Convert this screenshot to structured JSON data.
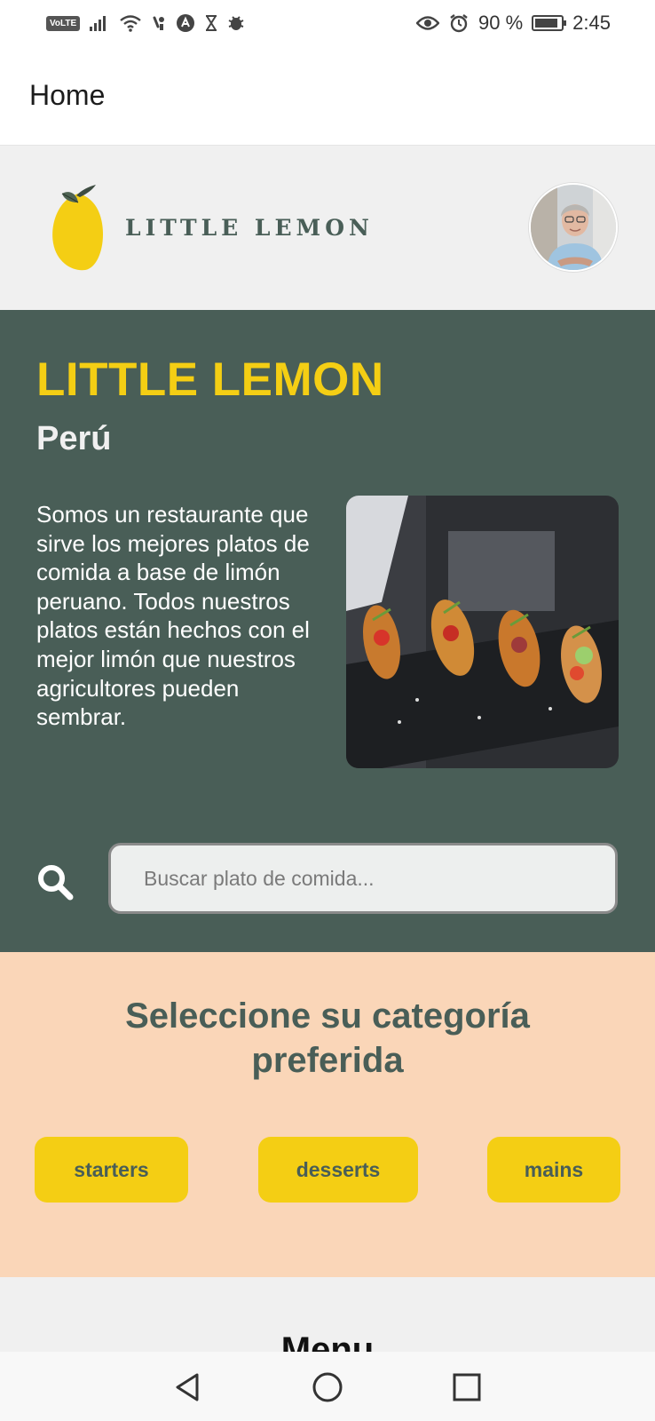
{
  "status_bar": {
    "volte": "VoLTE",
    "battery_percent": "90 %",
    "battery_level": 0.9,
    "time": "2:45",
    "icons": [
      "signal-icon",
      "wifi-icon",
      "notification-icon",
      "app-icon",
      "hourglass-icon",
      "bug-icon",
      "eye-icon",
      "alarm-icon",
      "battery-icon"
    ]
  },
  "app_bar": {
    "title": "Home"
  },
  "header": {
    "logo_text": "LITTLE LEMON",
    "logo_icon": "lemon-icon",
    "avatar": "profile-avatar"
  },
  "hero": {
    "title": "LITTLE LEMON",
    "subtitle": "Perú",
    "description": "Somos un restaurante que sirve los mejores platos de comida a base de limón peruano. Todos nuestros platos están hechos con el mejor limón que nuestros agricultores pueden sembrar.",
    "image": "hero-food-image",
    "search_icon": "search-icon",
    "search_placeholder": "Buscar plato de comida..."
  },
  "categories": {
    "title": "Seleccione su categoría preferida",
    "items": [
      "starters",
      "desserts",
      "mains"
    ]
  },
  "menu": {
    "title": "Menu"
  },
  "colors": {
    "primary_green": "#495e57",
    "primary_yellow": "#f4ce14",
    "peach": "#fad6b8",
    "light_gray": "#f0f0f0"
  },
  "nav_bar": {
    "icons": [
      "back-icon",
      "home-icon",
      "recents-icon"
    ]
  }
}
